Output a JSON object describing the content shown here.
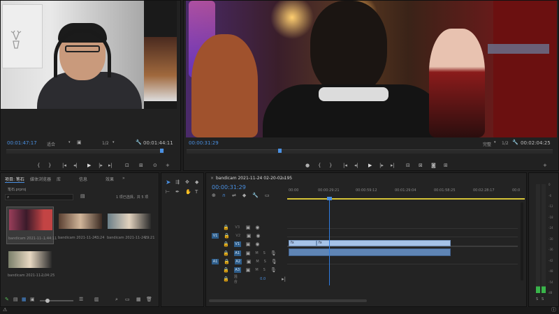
{
  "source_monitor": {
    "timecode": "00:01:47:17",
    "fit": "适合",
    "ratio": "1/2",
    "duration": "00:01:44:11"
  },
  "program_monitor": {
    "timecode": "00:00:31:29",
    "fit": "完整",
    "ratio": "1/2",
    "duration": "00:02:04:25"
  },
  "project": {
    "tabs": [
      "项目: 笔石",
      "媒体浏览器",
      "库",
      "信息",
      "效果"
    ],
    "file": "笔石.prproj",
    "count": "1 项已选择，共 5 项",
    "items": [
      {
        "name": "bandicam 2021-11-...",
        "dur": "1:44:11"
      },
      {
        "name": "bandicam 2021-11-24...",
        "dur": "43:24"
      },
      {
        "name": "bandicam 2021-11-24...",
        "dur": "29:21"
      },
      {
        "name": "bandicam 2021-11-...",
        "dur": "2:04:25"
      }
    ]
  },
  "timeline": {
    "tab": "bandicam 2021-11-24 02-20-02-195",
    "timecode": "00:00:31:29",
    "ruler": [
      "00:00",
      "00:00:29:21",
      "00:00:59:12",
      "00:01:29:04",
      "00:01:58:25",
      "00:02:28:17",
      "00:0"
    ],
    "tracks": [
      "V3",
      "V2",
      "V1",
      "A1",
      "A2",
      "A3"
    ],
    "master": "混合",
    "master_val": "0.0",
    "clip_label": "fx"
  },
  "meter": {
    "scale": [
      "0",
      "-6",
      "-12",
      "-18",
      "-24",
      "-30",
      "-36",
      "-42",
      "-48",
      "-54",
      "dB"
    ],
    "ss": [
      "S",
      "S"
    ]
  },
  "colors": {
    "accent": "#4a90e2",
    "clip_video": "#a6c3e8",
    "clip_audio": "#5f85b5",
    "playhead": "#2f7de1"
  }
}
